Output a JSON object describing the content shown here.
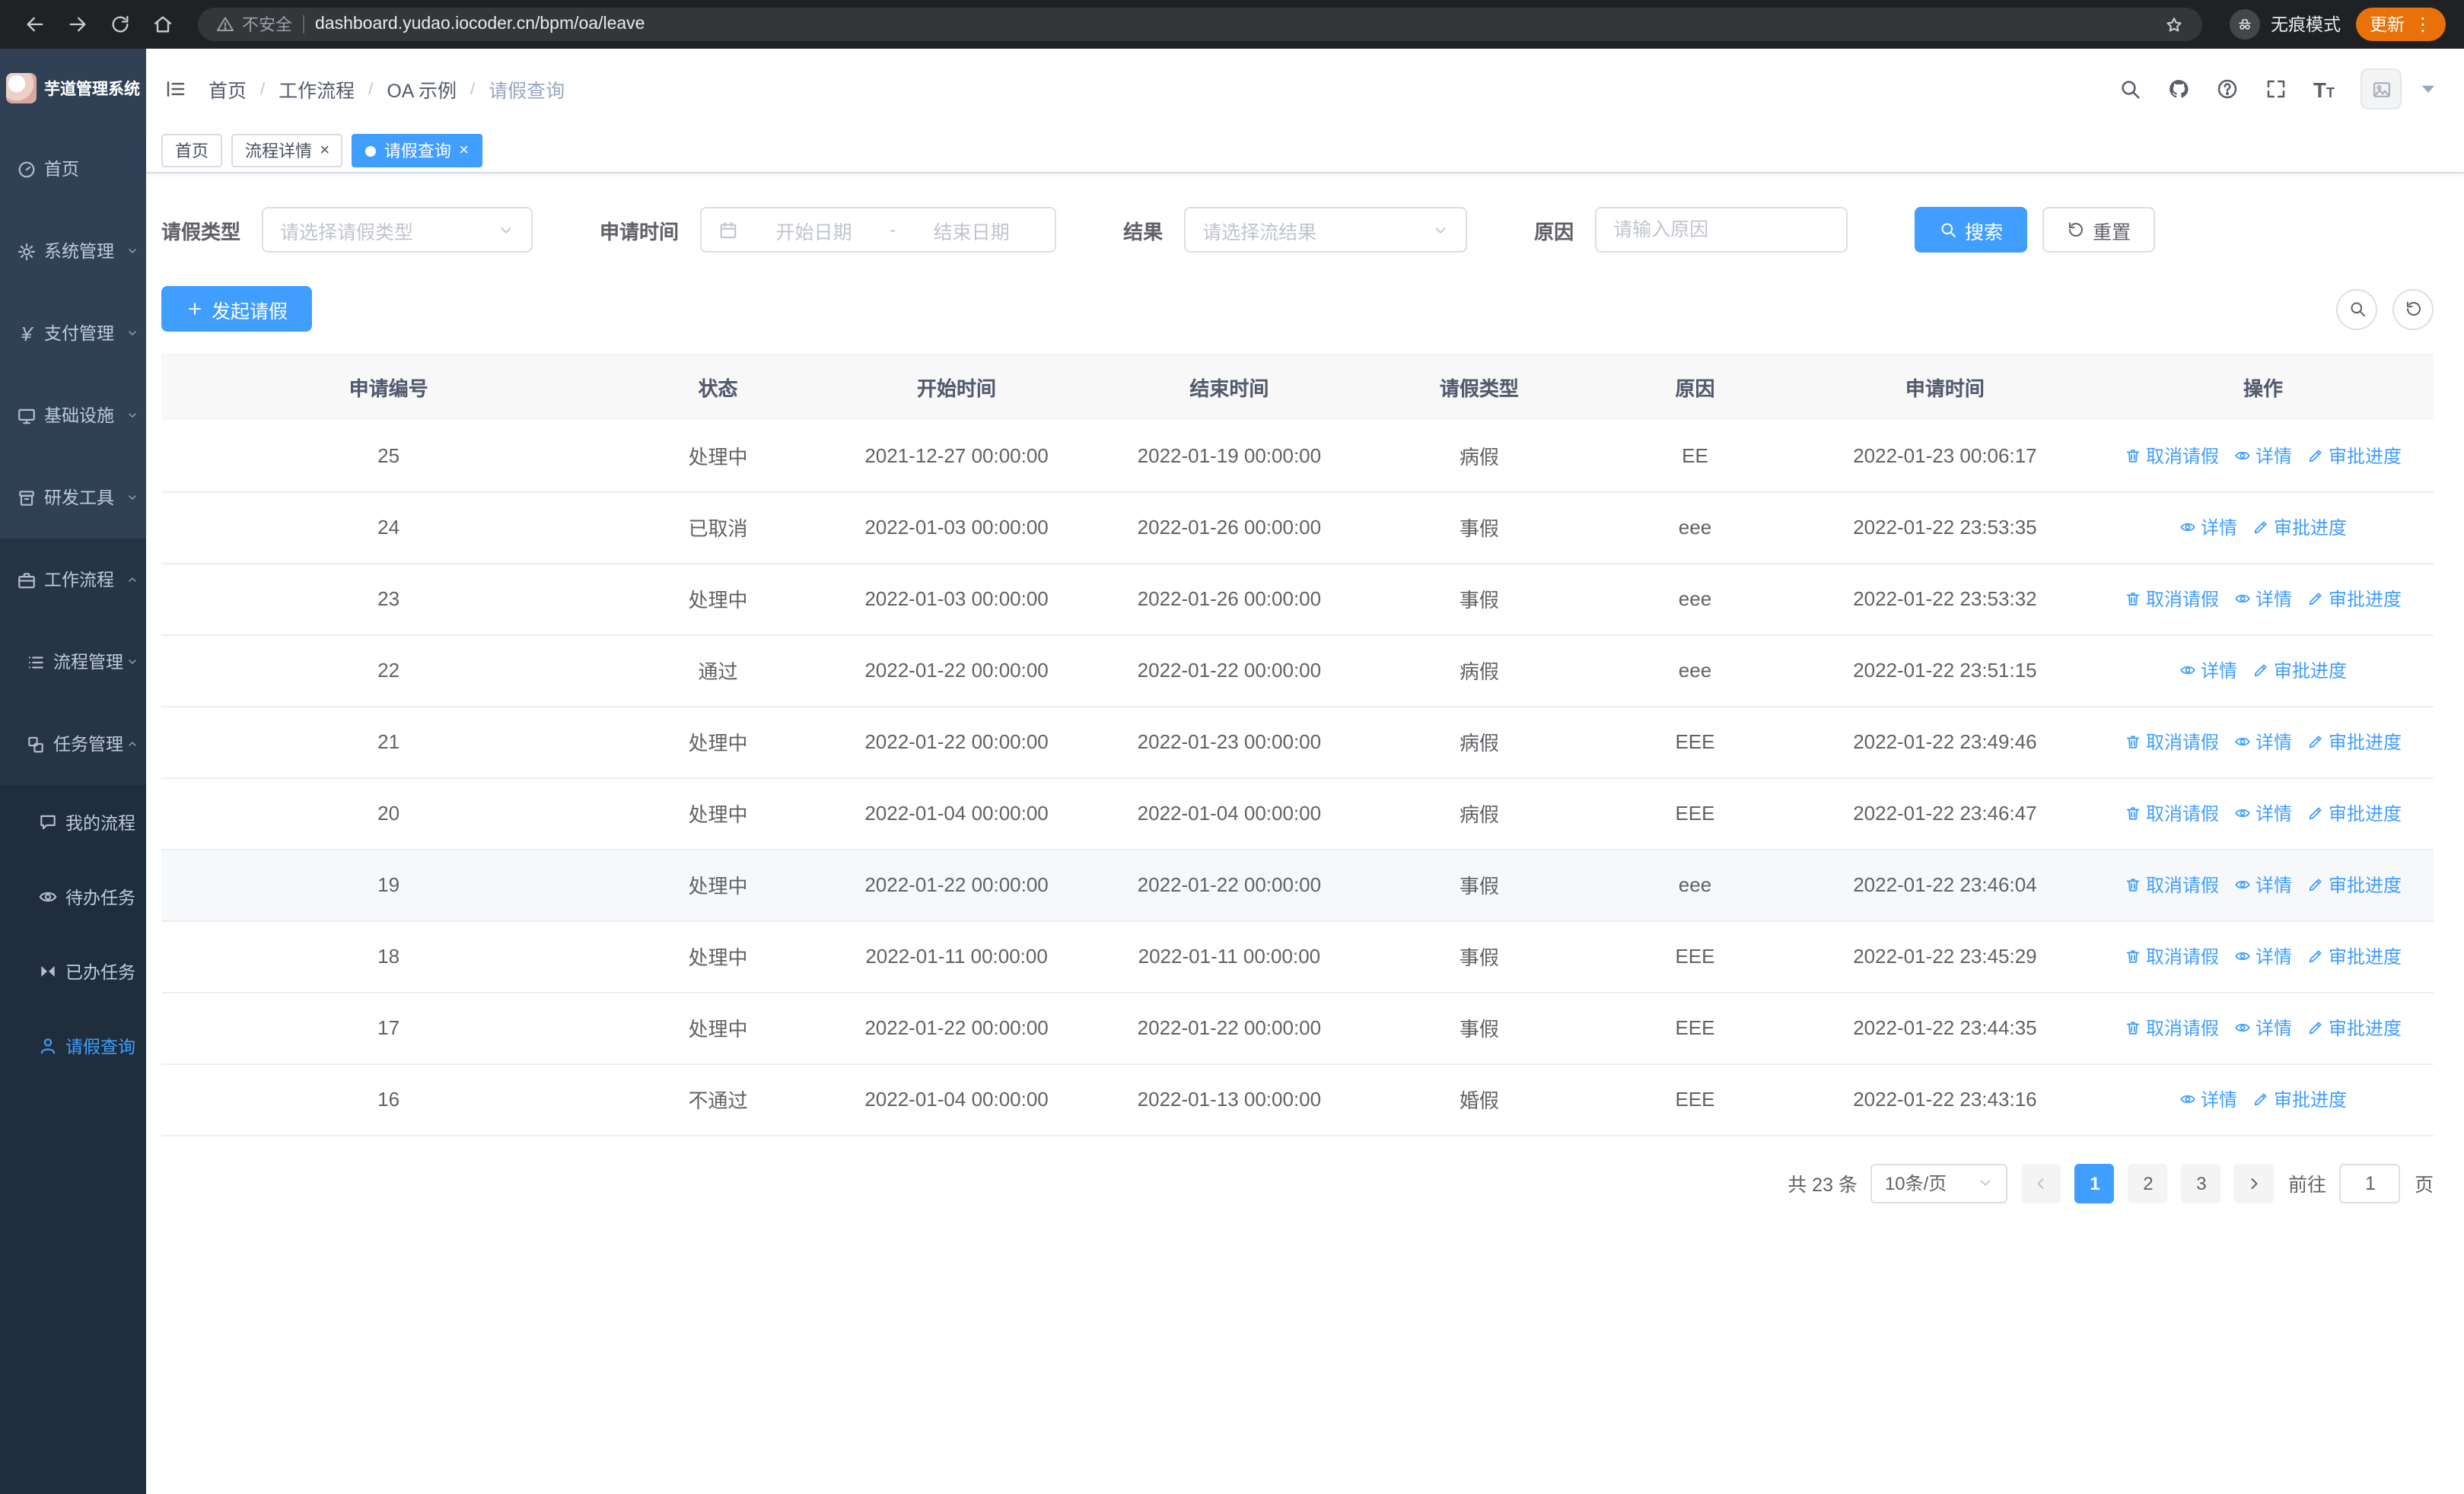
{
  "browser": {
    "security_label": "不安全",
    "url": "dashboard.yudao.iocoder.cn/bpm/oa/leave",
    "incognito_label": "无痕模式",
    "update_label": "更新"
  },
  "sidebar": {
    "logo_title": "芋道管理系统",
    "items": [
      {
        "label": "首页",
        "icon": "dashboard-icon",
        "level": 1
      },
      {
        "label": "系统管理",
        "icon": "gear-icon",
        "level": 1,
        "arrow": "down"
      },
      {
        "label": "支付管理",
        "icon": "yen-icon",
        "level": 1,
        "arrow": "down"
      },
      {
        "label": "基础设施",
        "icon": "monitor-icon",
        "level": 1,
        "arrow": "down"
      },
      {
        "label": "研发工具",
        "icon": "toolbox-icon",
        "level": 1,
        "arrow": "down"
      },
      {
        "label": "工作流程",
        "icon": "briefcase-icon",
        "level": 1,
        "arrow": "up",
        "expanded": true
      },
      {
        "label": "流程管理",
        "icon": "list-icon",
        "level": 2,
        "arrow": "down"
      },
      {
        "label": "任务管理",
        "icon": "layers-icon",
        "level": 2,
        "arrow": "up",
        "expanded": true
      },
      {
        "label": "我的流程",
        "icon": "chat-icon",
        "level": 3
      },
      {
        "label": "待办任务",
        "icon": "eye-icon",
        "level": 3
      },
      {
        "label": "已办任务",
        "icon": "bowtie-icon",
        "level": 3
      },
      {
        "label": "请假查询",
        "icon": "user-icon",
        "level": 3,
        "active": true
      }
    ]
  },
  "header": {
    "breadcrumb": [
      "首页",
      "工作流程",
      "OA 示例",
      "请假查询"
    ]
  },
  "tabs": [
    {
      "label": "首页",
      "closable": false,
      "active": false
    },
    {
      "label": "流程详情",
      "closable": true,
      "active": false
    },
    {
      "label": "请假查询",
      "closable": true,
      "active": true
    }
  ],
  "filters": {
    "leave_type_label": "请假类型",
    "leave_type_placeholder": "请选择请假类型",
    "apply_time_label": "申请时间",
    "start_placeholder": "开始日期",
    "range_separator": "-",
    "end_placeholder": "结束日期",
    "result_label": "结果",
    "result_placeholder": "请选择流结果",
    "reason_label": "原因",
    "reason_placeholder": "请输入原因",
    "search_label": "搜索",
    "reset_label": "重置"
  },
  "toolbar": {
    "create_label": "发起请假"
  },
  "table": {
    "columns": [
      "申请编号",
      "状态",
      "开始时间",
      "结束时间",
      "请假类型",
      "原因",
      "申请时间",
      "操作"
    ],
    "actions": {
      "cancel": "取消请假",
      "detail": "详情",
      "progress": "审批进度"
    },
    "rows": [
      {
        "id": "25",
        "status": "处理中",
        "start": "2021-12-27 00:00:00",
        "end": "2022-01-19 00:00:00",
        "type": "病假",
        "reason": "EE",
        "apply": "2022-01-23 00:06:17",
        "cancellable": true,
        "highlighted": false
      },
      {
        "id": "24",
        "status": "已取消",
        "start": "2022-01-03 00:00:00",
        "end": "2022-01-26 00:00:00",
        "type": "事假",
        "reason": "eee",
        "apply": "2022-01-22 23:53:35",
        "cancellable": false,
        "highlighted": false
      },
      {
        "id": "23",
        "status": "处理中",
        "start": "2022-01-03 00:00:00",
        "end": "2022-01-26 00:00:00",
        "type": "事假",
        "reason": "eee",
        "apply": "2022-01-22 23:53:32",
        "cancellable": true,
        "highlighted": false
      },
      {
        "id": "22",
        "status": "通过",
        "start": "2022-01-22 00:00:00",
        "end": "2022-01-22 00:00:00",
        "type": "病假",
        "reason": "eee",
        "apply": "2022-01-22 23:51:15",
        "cancellable": false,
        "highlighted": false
      },
      {
        "id": "21",
        "status": "处理中",
        "start": "2022-01-22 00:00:00",
        "end": "2022-01-23 00:00:00",
        "type": "病假",
        "reason": "EEE",
        "apply": "2022-01-22 23:49:46",
        "cancellable": true,
        "highlighted": false
      },
      {
        "id": "20",
        "status": "处理中",
        "start": "2022-01-04 00:00:00",
        "end": "2022-01-04 00:00:00",
        "type": "病假",
        "reason": "EEE",
        "apply": "2022-01-22 23:46:47",
        "cancellable": true,
        "highlighted": false
      },
      {
        "id": "19",
        "status": "处理中",
        "start": "2022-01-22 00:00:00",
        "end": "2022-01-22 00:00:00",
        "type": "事假",
        "reason": "eee",
        "apply": "2022-01-22 23:46:04",
        "cancellable": true,
        "highlighted": true
      },
      {
        "id": "18",
        "status": "处理中",
        "start": "2022-01-11 00:00:00",
        "end": "2022-01-11 00:00:00",
        "type": "事假",
        "reason": "EEE",
        "apply": "2022-01-22 23:45:29",
        "cancellable": true,
        "highlighted": false
      },
      {
        "id": "17",
        "status": "处理中",
        "start": "2022-01-22 00:00:00",
        "end": "2022-01-22 00:00:00",
        "type": "事假",
        "reason": "EEE",
        "apply": "2022-01-22 23:44:35",
        "cancellable": true,
        "highlighted": false
      },
      {
        "id": "16",
        "status": "不通过",
        "start": "2022-01-04 00:00:00",
        "end": "2022-01-13 00:00:00",
        "type": "婚假",
        "reason": "EEE",
        "apply": "2022-01-22 23:43:16",
        "cancellable": false,
        "highlighted": false
      }
    ]
  },
  "pagination": {
    "total_label": "共 23 条",
    "page_size": "10条/页",
    "pages": [
      "1",
      "2",
      "3"
    ],
    "active_page": "1",
    "goto_label": "前往",
    "goto_value": "1",
    "unit_label": "页"
  },
  "colors": {
    "accent": "#409eff",
    "sidebar_bg": "#304156",
    "sidebar_dark": "#1f2d3d",
    "chrome_bg": "#202124",
    "update_pill": "#e8710a",
    "table_header_bg": "#f8f8f9"
  }
}
